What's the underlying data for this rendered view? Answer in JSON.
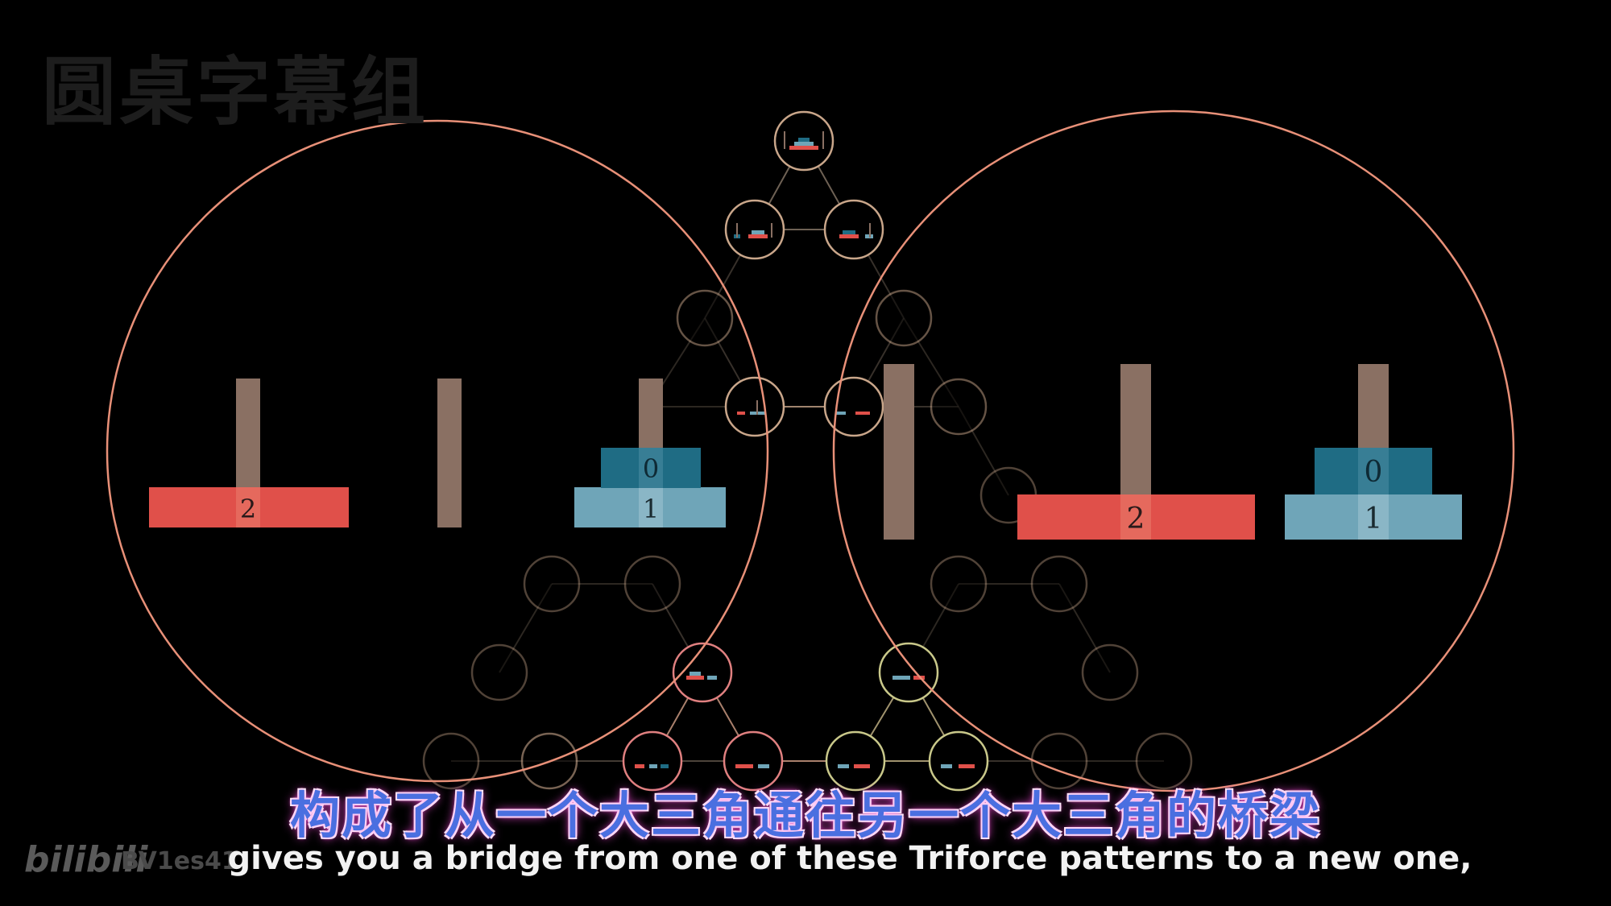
{
  "watermark_text": "圆桌字幕组",
  "subtitle_chinese": "构成了从一个大三角通往另一个大三角的桥梁",
  "subtitle_english": "gives you a bridge from one of these Triforce patterns to a new one,",
  "bilibili_logo": "bilibili",
  "video_id": "BV1es41",
  "colors": {
    "background": "#000000",
    "big_circle": "#e89078",
    "peg": "#8a7063",
    "disk_large": "#e0504a",
    "disk_medium": "#6fa5b8",
    "disk_small": "#1f6c84",
    "node_ring": "#c9a68a"
  },
  "left_state": {
    "disk_large_label": "2",
    "disk_medium_label": "1",
    "disk_small_label": "0"
  },
  "right_state": {
    "disk_large_label": "2",
    "disk_medium_label": "1",
    "disk_small_label": "0"
  }
}
